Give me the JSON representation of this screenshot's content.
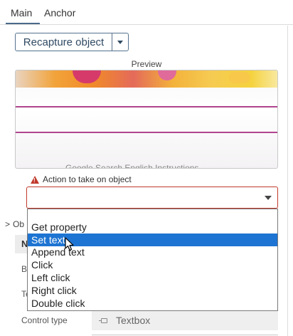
{
  "tabs": [
    {
      "label": "Main",
      "active": true
    },
    {
      "label": "Anchor",
      "active": false
    }
  ],
  "toolbar": {
    "recapture_label": "Recapture object",
    "recapture_dropdown_icon": "chevron-down-icon"
  },
  "preview": {
    "label": "Preview",
    "partial_text": "Google Search   English   Instructions"
  },
  "action": {
    "label": "Action to take on object",
    "status_icon": "warning-icon",
    "status_color": "#c0392b",
    "selected_value": "",
    "options": [
      "",
      "Get property",
      "Set text",
      "Append text",
      "Click",
      "Left click",
      "Right click",
      "Double click"
    ],
    "highlighted_option": "Set text",
    "highlight_color": "#1e74d2"
  },
  "properties": {
    "section_partial_label": "Ob",
    "header_partial": "N",
    "row1_partial": "B",
    "row2_partial": "Te",
    "control_type_label": "Control type",
    "control_type_value": "Textbox",
    "control_type_icon": "textbox-icon"
  }
}
